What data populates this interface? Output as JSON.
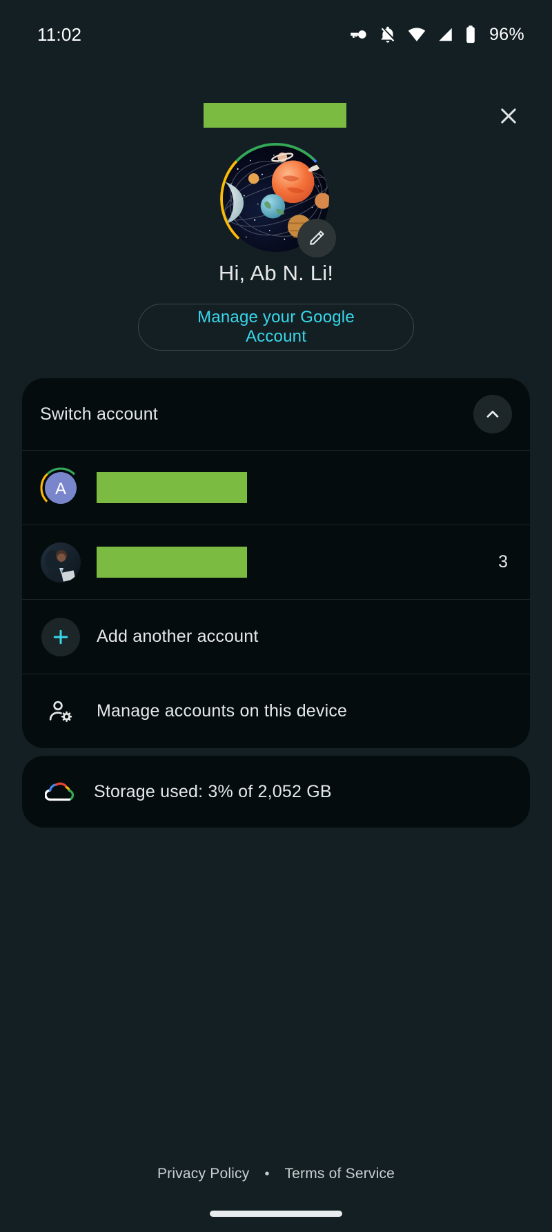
{
  "status_bar": {
    "time": "11:02",
    "battery_percent": "96%",
    "icons": [
      "vpn-key-icon",
      "notifications-off-icon",
      "wifi-icon",
      "cellular-signal-icon",
      "battery-icon"
    ]
  },
  "header": {
    "title_redacted": true,
    "title_text": "",
    "close_label": "Close",
    "close_icon": "close-icon"
  },
  "profile": {
    "avatar_alt": "solar-system-avatar",
    "edit_icon": "pencil-edit-icon",
    "greeting": "Hi, Ab N. Li!",
    "manage_button_label": "Manage your Google Account"
  },
  "switch_account": {
    "header_label": "Switch account",
    "collapse_icon": "chevron-up-icon",
    "expanded": true,
    "accounts": [
      {
        "avatar_type": "letter-avatar",
        "avatar_letter": "A",
        "name_redacted": true,
        "name_text": "",
        "badge_count": ""
      },
      {
        "avatar_type": "photo-avatar",
        "avatar_letter": "",
        "name_redacted": true,
        "name_text": "",
        "badge_count": "3"
      }
    ],
    "actions": [
      {
        "icon": "plus-icon",
        "label": "Add another account"
      },
      {
        "icon": "manage-accounts-icon",
        "label": "Manage accounts on this device"
      }
    ]
  },
  "storage": {
    "icon": "google-one-cloud-icon",
    "label": "Storage used: 3% of 2,052 GB"
  },
  "footer": {
    "privacy_label": "Privacy Policy",
    "separator": "•",
    "terms_label": "Terms of Service"
  },
  "colors": {
    "background": "#131f23",
    "card": "#050c0e",
    "accent_cyan": "#39d7ea",
    "redaction_green": "#7cbb42",
    "text_primary": "#e6e8e8"
  }
}
